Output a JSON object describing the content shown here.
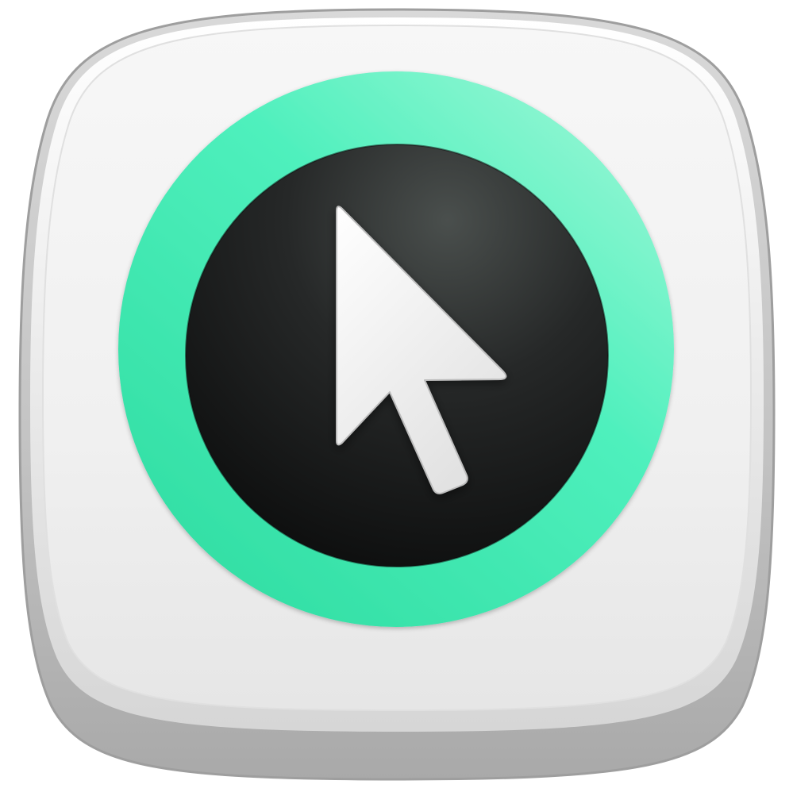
{
  "icon": {
    "name": "cursor-app-icon",
    "depicts": "mouse-pointer-arrow-icon",
    "colors": {
      "background": "#ffffff",
      "base_outer": "#bdbdbd",
      "base_top": "#f2f2f2",
      "ring_accent": "#3ee8b0",
      "disc_dark": "#1c1d1d",
      "cursor_fill": "#f4f4f4"
    }
  }
}
